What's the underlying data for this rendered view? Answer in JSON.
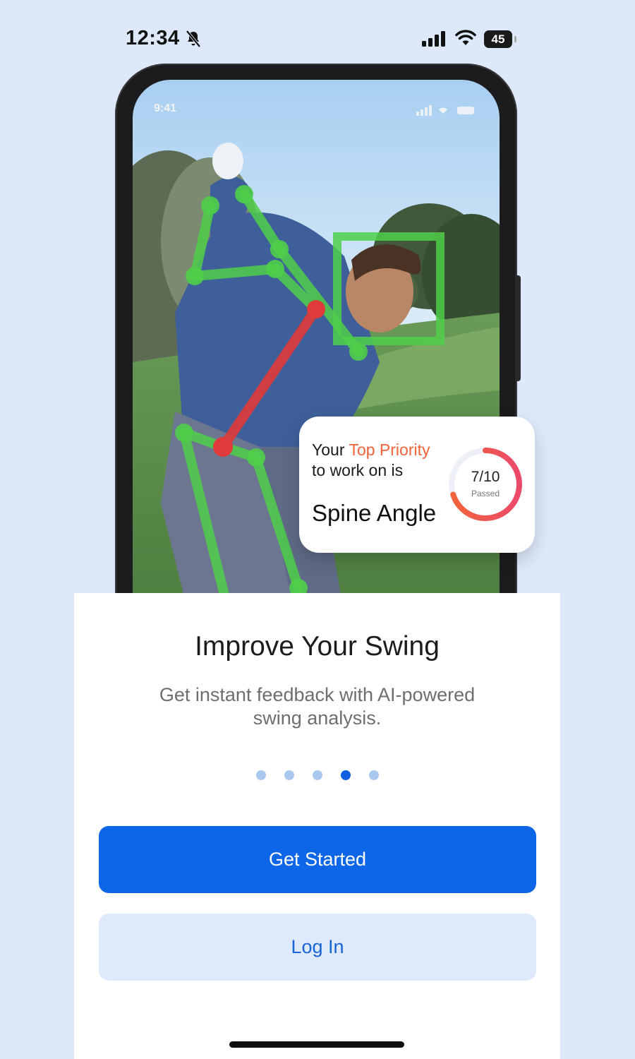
{
  "status_bar": {
    "time": "12:34",
    "battery": "45"
  },
  "mockup": {
    "inner_time": "9:41",
    "card": {
      "line1_prefix": "Your ",
      "line1_accent": "Top Priority",
      "line2": "to work on is",
      "title": "Spine Angle",
      "score": "7/10",
      "score_label": "Passed",
      "score_value": 7,
      "score_max": 10
    }
  },
  "onboarding": {
    "title": "Improve Your Swing",
    "subtitle": "Get instant feedback with AI-powered swing analysis.",
    "page_count": 5,
    "active_page": 4
  },
  "buttons": {
    "primary": "Get Started",
    "secondary": "Log In"
  },
  "colors": {
    "primary": "#0d66e7",
    "accent": "#f2633a",
    "skeleton": "#4fcf4a",
    "spine": "#e03a3a"
  }
}
